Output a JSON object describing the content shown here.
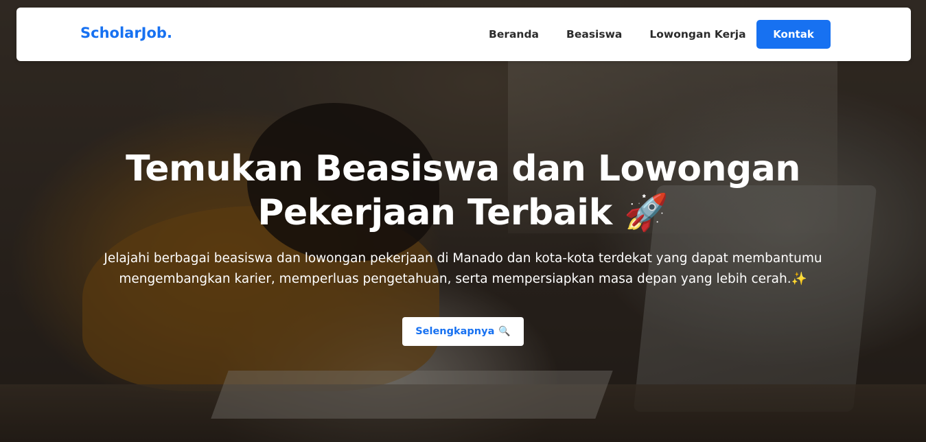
{
  "navbar": {
    "brand": "ScholarJob.",
    "links": [
      "Beranda",
      "Beasiswa",
      "Lowongan Kerja"
    ],
    "contact_label": "Kontak"
  },
  "hero": {
    "title_line1": "Temukan Beasiswa dan Lowongan",
    "title_line2": "Pekerjaan Terbaik",
    "title_emoji": "🚀",
    "subtitle": "Jelajahi berbagai beasiswa dan lowongan pekerjaan di Manado dan kota-kota terdekat yang dapat membantumu mengembangkan karier, memperluas pengetahuan, serta mempersiapkan masa depan yang lebih cerah.",
    "subtitle_emoji": "✨",
    "button_label": "Selengkapnya",
    "button_icon": "🔍"
  },
  "icons": {
    "title_icon": "rocket-icon",
    "subtitle_icon": "sparkles-icon",
    "button_icon": "magnifying-glass-icon"
  },
  "colors": {
    "brand": "#1771f1",
    "navbar_bg": "#ffffff",
    "hero_text": "#ffffff"
  }
}
